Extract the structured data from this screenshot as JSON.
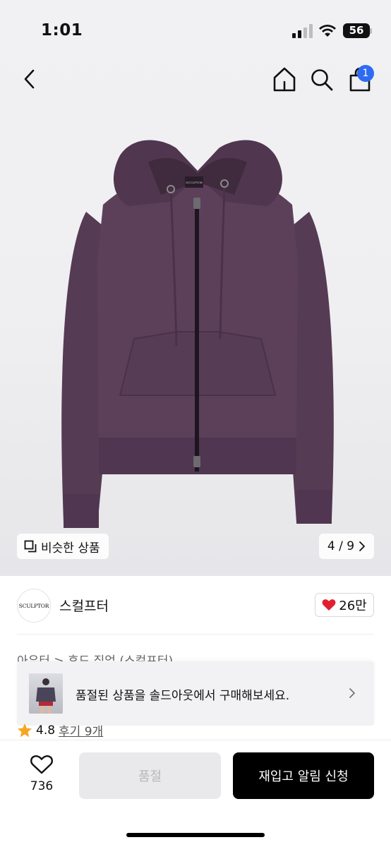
{
  "status_bar": {
    "time": "1:01",
    "battery": "56"
  },
  "nav": {
    "cart_badge": "1",
    "icons": [
      "back-chevron-icon",
      "home-icon",
      "search-icon",
      "shopping-bag-icon"
    ]
  },
  "gallery": {
    "similar_label": "비슷한 상품",
    "page_indicator": "4 / 9",
    "image_logo_text": "SCULPTOR"
  },
  "brand": {
    "logo_text": "SCULPTOR",
    "name": "스컬프터",
    "likes": "26만"
  },
  "breadcrumb": "아우터 > 후드 집업 (스컬프터)",
  "soldout_toast": {
    "message": "품절된 상품을 솔드아웃에서 구매해보세요."
  },
  "rating": {
    "value": "4.8",
    "reviews": "후기 9개"
  },
  "bottom_bar": {
    "wish_count": "736",
    "soldout_label": "품절",
    "restock_label": "재입고 알림 신청"
  },
  "colors": {
    "accent_badge": "#2f6bf2",
    "heart": "#e0202f",
    "star": "#f5a623",
    "hoodie": "#5a3e58"
  }
}
